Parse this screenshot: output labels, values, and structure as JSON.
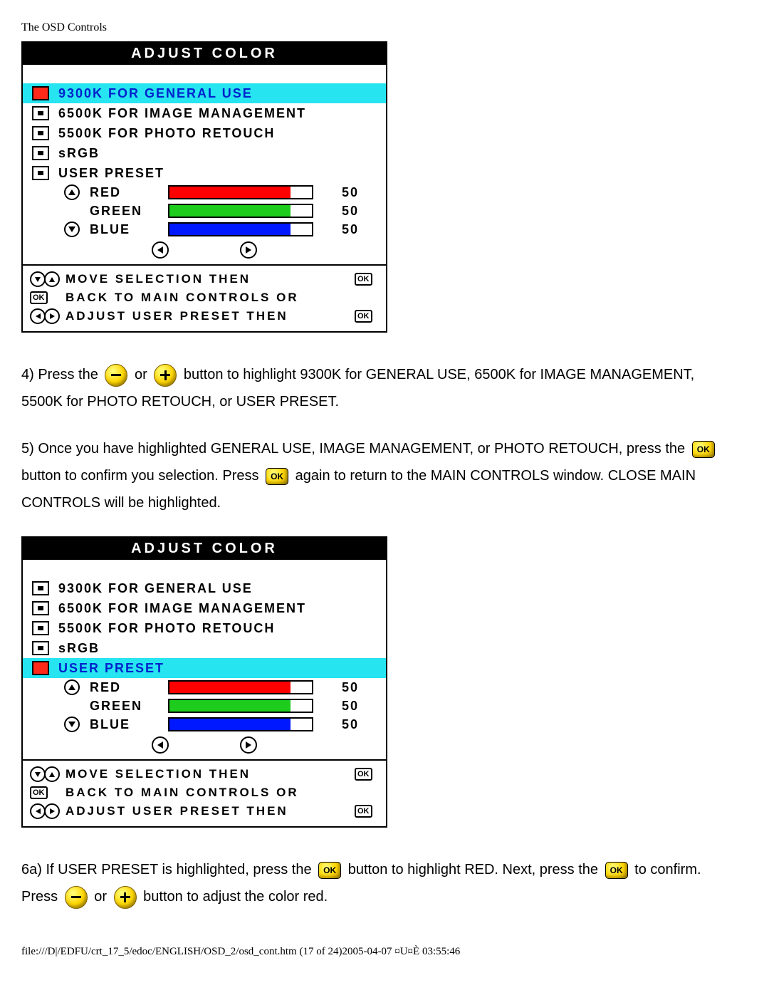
{
  "page_title": "The OSD Controls",
  "osd_title": "ADJUST COLOR",
  "panels": [
    {
      "selected_index": 0
    },
    {
      "selected_index": 4
    }
  ],
  "items": [
    {
      "label": "9300K FOR GENERAL USE"
    },
    {
      "label": "6500K FOR IMAGE MANAGEMENT"
    },
    {
      "label": "5500K FOR PHOTO RETOUCH"
    },
    {
      "label": "sRGB"
    },
    {
      "label": "USER PRESET"
    }
  ],
  "colors": {
    "red": {
      "label": "RED",
      "value": "50",
      "pct": 85
    },
    "green": {
      "label": "GREEN",
      "value": "50",
      "pct": 85
    },
    "blue": {
      "label": "BLUE",
      "value": "50",
      "pct": 85
    }
  },
  "hints": {
    "move": "MOVE SELECTION THEN",
    "back": "BACK TO MAIN CONTROLS OR",
    "adjust": "ADJUST USER PRESET THEN"
  },
  "ok_label": "OK",
  "text": {
    "p1a": "4) Press the",
    "p1b": "or",
    "p1c": "button to highlight 9300K for GENERAL USE, 6500K for IMAGE MANAGEMENT, 5500K for PHOTO RETOUCH, or USER PRESET.",
    "p2a": "5) Once you have highlighted GENERAL USE, IMAGE MANAGEMENT, or PHOTO RETOUCH, press the",
    "p2b": "button to confirm you selection. Press",
    "p2c": "again to return to the MAIN CONTROLS window. CLOSE MAIN CONTROLS will be highlighted.",
    "p3a": "6a) If USER PRESET is highlighted, press the",
    "p3b": "button to highlight RED. Next, press the",
    "p3c": "to confirm. Press",
    "p3d": "or",
    "p3e": "button to adjust the color red."
  },
  "footer": "file:///D|/EDFU/crt_17_5/edoc/ENGLISH/OSD_2/osd_cont.htm (17 of 24)2005-04-07 ¤U¤È 03:55:46"
}
